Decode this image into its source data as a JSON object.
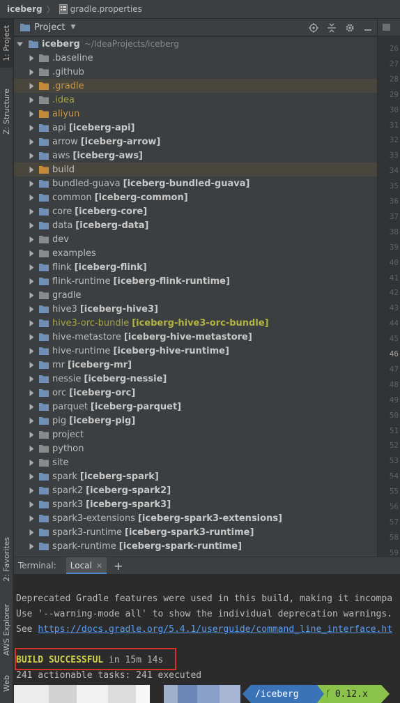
{
  "breadcrumb": {
    "root": "iceberg",
    "file": "gradle.properties"
  },
  "left_strip": {
    "tabs": [
      {
        "label": "1: Project",
        "active": true
      },
      {
        "label": "Z: Structure",
        "active": false
      },
      {
        "label": "2: Favorites",
        "active": false
      },
      {
        "label": "AWS Explorer",
        "active": false
      },
      {
        "label": "Web",
        "active": false
      }
    ]
  },
  "project_panel": {
    "title": "Project",
    "toolbar_icons": [
      "locate-icon",
      "collapse-icon",
      "gear-icon",
      "hide-icon"
    ]
  },
  "tree": {
    "root": {
      "name": "iceberg",
      "path": "~/IdeaProjects/iceberg"
    },
    "items": [
      {
        "name": ".baseline",
        "module": ""
      },
      {
        "name": ".github",
        "module": ""
      },
      {
        "name": ".gradle",
        "module": "",
        "color": "orange",
        "highlight": true
      },
      {
        "name": ".idea",
        "module": "",
        "color": "olive"
      },
      {
        "name": "aliyun",
        "module": "",
        "color": "orange"
      },
      {
        "name": "api",
        "module": "[iceberg-api]"
      },
      {
        "name": "arrow",
        "module": "[iceberg-arrow]"
      },
      {
        "name": "aws",
        "module": "[iceberg-aws]"
      },
      {
        "name": "build",
        "module": "",
        "color": "orange-folder",
        "highlight": true
      },
      {
        "name": "bundled-guava",
        "module": "[iceberg-bundled-guava]"
      },
      {
        "name": "common",
        "module": "[iceberg-common]"
      },
      {
        "name": "core",
        "module": "[iceberg-core]"
      },
      {
        "name": "data",
        "module": "[iceberg-data]"
      },
      {
        "name": "dev",
        "module": ""
      },
      {
        "name": "examples",
        "module": ""
      },
      {
        "name": "flink",
        "module": "[iceberg-flink]"
      },
      {
        "name": "flink-runtime",
        "module": "[iceberg-flink-runtime]"
      },
      {
        "name": "gradle",
        "module": ""
      },
      {
        "name": "hive3",
        "module": "[iceberg-hive3]"
      },
      {
        "name": "hive3-orc-bundle",
        "module": "[iceberg-hive3-orc-bundle]",
        "color": "olive"
      },
      {
        "name": "hive-metastore",
        "module": "[iceberg-hive-metastore]"
      },
      {
        "name": "hive-runtime",
        "module": "[iceberg-hive-runtime]"
      },
      {
        "name": "mr",
        "module": "[iceberg-mr]"
      },
      {
        "name": "nessie",
        "module": "[iceberg-nessie]"
      },
      {
        "name": "orc",
        "module": "[iceberg-orc]"
      },
      {
        "name": "parquet",
        "module": "[iceberg-parquet]"
      },
      {
        "name": "pig",
        "module": "[iceberg-pig]"
      },
      {
        "name": "project",
        "module": ""
      },
      {
        "name": "python",
        "module": ""
      },
      {
        "name": "site",
        "module": ""
      },
      {
        "name": "spark",
        "module": "[iceberg-spark]"
      },
      {
        "name": "spark2",
        "module": "[iceberg-spark2]"
      },
      {
        "name": "spark3",
        "module": "[iceberg-spark3]"
      },
      {
        "name": "spark3-extensions",
        "module": "[iceberg-spark3-extensions]"
      },
      {
        "name": "spark3-runtime",
        "module": "[iceberg-spark3-runtime]"
      },
      {
        "name": "spark-runtime",
        "module": "[iceberg-spark-runtime]"
      }
    ]
  },
  "gutter": {
    "line_numbers": [
      "26",
      "27",
      "28",
      "29",
      "30",
      "31",
      "32",
      "33",
      "34",
      "35",
      "36",
      "37",
      "38",
      "39",
      "40",
      "41",
      "42",
      "43",
      "44",
      "45",
      "46",
      "47",
      "48",
      "49",
      "50",
      "51",
      "52",
      "53",
      "54",
      "55",
      "56",
      "57",
      "58",
      "59"
    ],
    "current_line": "46"
  },
  "terminal": {
    "label": "Terminal:",
    "tab": "Local",
    "lines": {
      "l1": "Deprecated Gradle features were used in this build, making it incompa",
      "l2": "Use '--warning-mode all' to show the individual deprecation warnings.",
      "l3_prefix": "See ",
      "l3_link": "https://docs.gradle.org/5.4.1/userguide/command_line_interface.ht",
      "build_status": "BUILD SUCCESSFUL",
      "build_time": " in 15m 14s",
      "tasks": "241 actionable tasks: 241 executed"
    },
    "prompt": {
      "dir": "/iceberg",
      "git": "0.12.x"
    }
  },
  "colors": {
    "accent": "#4a88c7",
    "success": "#cfd04f",
    "annotation_box": "#d8302b",
    "prompt_dir_bg": "#3b73b9",
    "prompt_git_bg": "#8bc34a"
  }
}
